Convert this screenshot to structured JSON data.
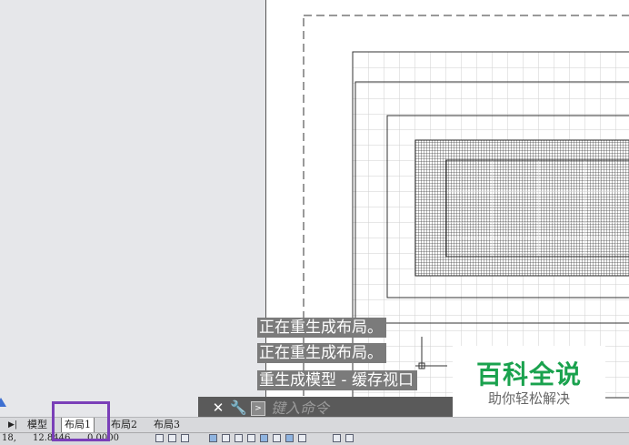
{
  "command_history": {
    "line1": "正在重生成布局。",
    "line2": "正在重生成布局。",
    "line3": "重生成模型 - 缓存视口"
  },
  "command_line": {
    "placeholder": "键入命令",
    "close_icon": "close-icon",
    "customize_icon": "wrench-icon",
    "prompt_icon": "command-prompt-icon"
  },
  "layout_tabs": {
    "nav_icon": "tab-nav-last-icon",
    "tabs": [
      "模型",
      "布局1",
      "布局2",
      "布局3"
    ],
    "active": "布局1"
  },
  "status_bar": {
    "coord_x": "18,",
    "coord_y": "12.8446",
    "coord_z": "0.0000"
  },
  "watermark": {
    "title": "百科全说",
    "subtitle": "助你轻松解决"
  },
  "colors": {
    "highlight": "#7a3fb8",
    "watermark_green": "#1aa24e",
    "workspace": "#e6e7ea"
  }
}
